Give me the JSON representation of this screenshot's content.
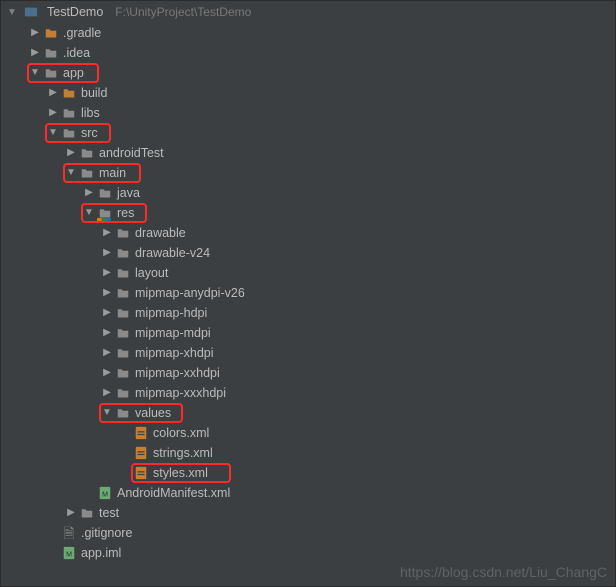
{
  "header": {
    "project": "TestDemo",
    "path": "F:\\UnityProject\\TestDemo"
  },
  "tree": [
    {
      "indent": 1,
      "arrow": "right",
      "icon": "folder-orange",
      "label": ".gradle"
    },
    {
      "indent": 1,
      "arrow": "right",
      "icon": "folder-gray",
      "label": ".idea"
    },
    {
      "indent": 1,
      "arrow": "down",
      "icon": "folder-gray",
      "label": "app",
      "hl": true,
      "hlw": 72
    },
    {
      "indent": 2,
      "arrow": "right",
      "icon": "folder-orange",
      "label": "build"
    },
    {
      "indent": 2,
      "arrow": "right",
      "icon": "folder-gray",
      "label": "libs"
    },
    {
      "indent": 2,
      "arrow": "down",
      "icon": "folder-gray",
      "label": "src",
      "hl": true,
      "hlw": 66
    },
    {
      "indent": 3,
      "arrow": "right",
      "icon": "folder-gray",
      "label": "androidTest"
    },
    {
      "indent": 3,
      "arrow": "down",
      "icon": "folder-gray",
      "label": "main",
      "hl": true,
      "hlw": 78
    },
    {
      "indent": 4,
      "arrow": "right",
      "icon": "folder-gray",
      "label": "java"
    },
    {
      "indent": 4,
      "arrow": "down",
      "icon": "folder-res",
      "label": "res",
      "hl": true,
      "hlw": 66
    },
    {
      "indent": 5,
      "arrow": "right",
      "icon": "folder-gray",
      "label": "drawable"
    },
    {
      "indent": 5,
      "arrow": "right",
      "icon": "folder-gray",
      "label": "drawable-v24"
    },
    {
      "indent": 5,
      "arrow": "right",
      "icon": "folder-gray",
      "label": "layout"
    },
    {
      "indent": 5,
      "arrow": "right",
      "icon": "folder-gray",
      "label": "mipmap-anydpi-v26"
    },
    {
      "indent": 5,
      "arrow": "right",
      "icon": "folder-gray",
      "label": "mipmap-hdpi"
    },
    {
      "indent": 5,
      "arrow": "right",
      "icon": "folder-gray",
      "label": "mipmap-mdpi"
    },
    {
      "indent": 5,
      "arrow": "right",
      "icon": "folder-gray",
      "label": "mipmap-xhdpi"
    },
    {
      "indent": 5,
      "arrow": "right",
      "icon": "folder-gray",
      "label": "mipmap-xxhdpi"
    },
    {
      "indent": 5,
      "arrow": "right",
      "icon": "folder-gray",
      "label": "mipmap-xxxhdpi"
    },
    {
      "indent": 5,
      "arrow": "down",
      "icon": "folder-gray",
      "label": "values",
      "hl": true,
      "hlw": 84
    },
    {
      "indent": 6,
      "arrow": "none",
      "icon": "file-xml",
      "label": "colors.xml"
    },
    {
      "indent": 6,
      "arrow": "none",
      "icon": "file-xml",
      "label": "strings.xml"
    },
    {
      "indent": 6,
      "arrow": "none",
      "icon": "file-xml",
      "label": "styles.xml",
      "hl": true,
      "hlw": 100,
      "hloff": 14
    },
    {
      "indent": 4,
      "arrow": "none",
      "icon": "file-app",
      "label": "AndroidManifest.xml"
    },
    {
      "indent": 3,
      "arrow": "right",
      "icon": "folder-gray",
      "label": "test"
    },
    {
      "indent": 2,
      "arrow": "none",
      "icon": "file-txt",
      "label": ".gitignore"
    },
    {
      "indent": 2,
      "arrow": "none",
      "icon": "file-app",
      "label": "app.iml"
    }
  ],
  "watermark": "https://blog.csdn.net/Liu_ChangC"
}
